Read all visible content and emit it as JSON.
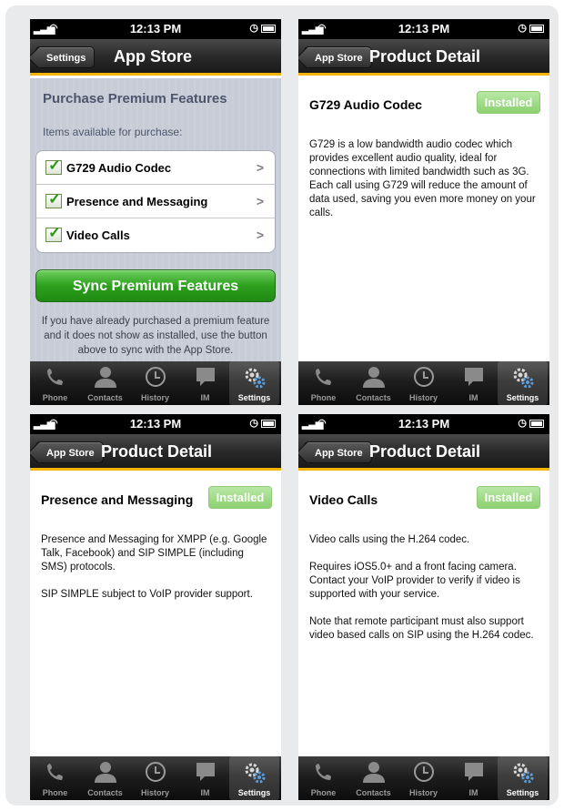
{
  "status": {
    "time": "12:13 PM"
  },
  "tabs": [
    "Phone",
    "Contacts",
    "History",
    "IM",
    "Settings"
  ],
  "store": {
    "back_label": "Settings",
    "title": "App Store",
    "heading": "Purchase Premium Features",
    "subheading": "Items available for purchase:",
    "items": [
      {
        "label": "G729 Audio Codec"
      },
      {
        "label": "Presence and Messaging"
      },
      {
        "label": "Video Calls"
      }
    ],
    "sync_label": "Sync Premium Features",
    "note": "If you have already purchased a premium feature and it does not show as installed, use the button above to sync with the App Store."
  },
  "details": [
    {
      "back_label": "App Store",
      "title": "Product Detail",
      "item_title": "G729 Audio Codec",
      "installed_label": "Installed",
      "paragraphs": [
        "G729 is a low bandwidth audio codec which provides excellent audio quality, ideal for connections with limited bandwidth such as 3G.  Each call using G729 will reduce the amount of data used, saving you even more money on your calls."
      ]
    },
    {
      "back_label": "App Store",
      "title": "Product Detail",
      "item_title": "Presence and Messaging",
      "installed_label": "Installed",
      "paragraphs": [
        "Presence and Messaging for XMPP (e.g. Google Talk, Facebook) and SIP SIMPLE (including SMS) protocols.",
        "SIP SIMPLE subject to VoIP provider support."
      ]
    },
    {
      "back_label": "App Store",
      "title": "Product Detail",
      "item_title": "Video Calls",
      "installed_label": "Installed",
      "paragraphs": [
        "Video calls using the H.264 codec.",
        "Requires iOS5.0+ and a front facing camera. Contact your VoIP provider to verify if video is supported with your service.",
        "Note that remote participant must also support video based calls on SIP using the H.264 codec."
      ]
    }
  ],
  "colors": {
    "accent_bar": "#f5b400",
    "installed_green": "#8cd170",
    "sync_green": "#2da01e"
  }
}
